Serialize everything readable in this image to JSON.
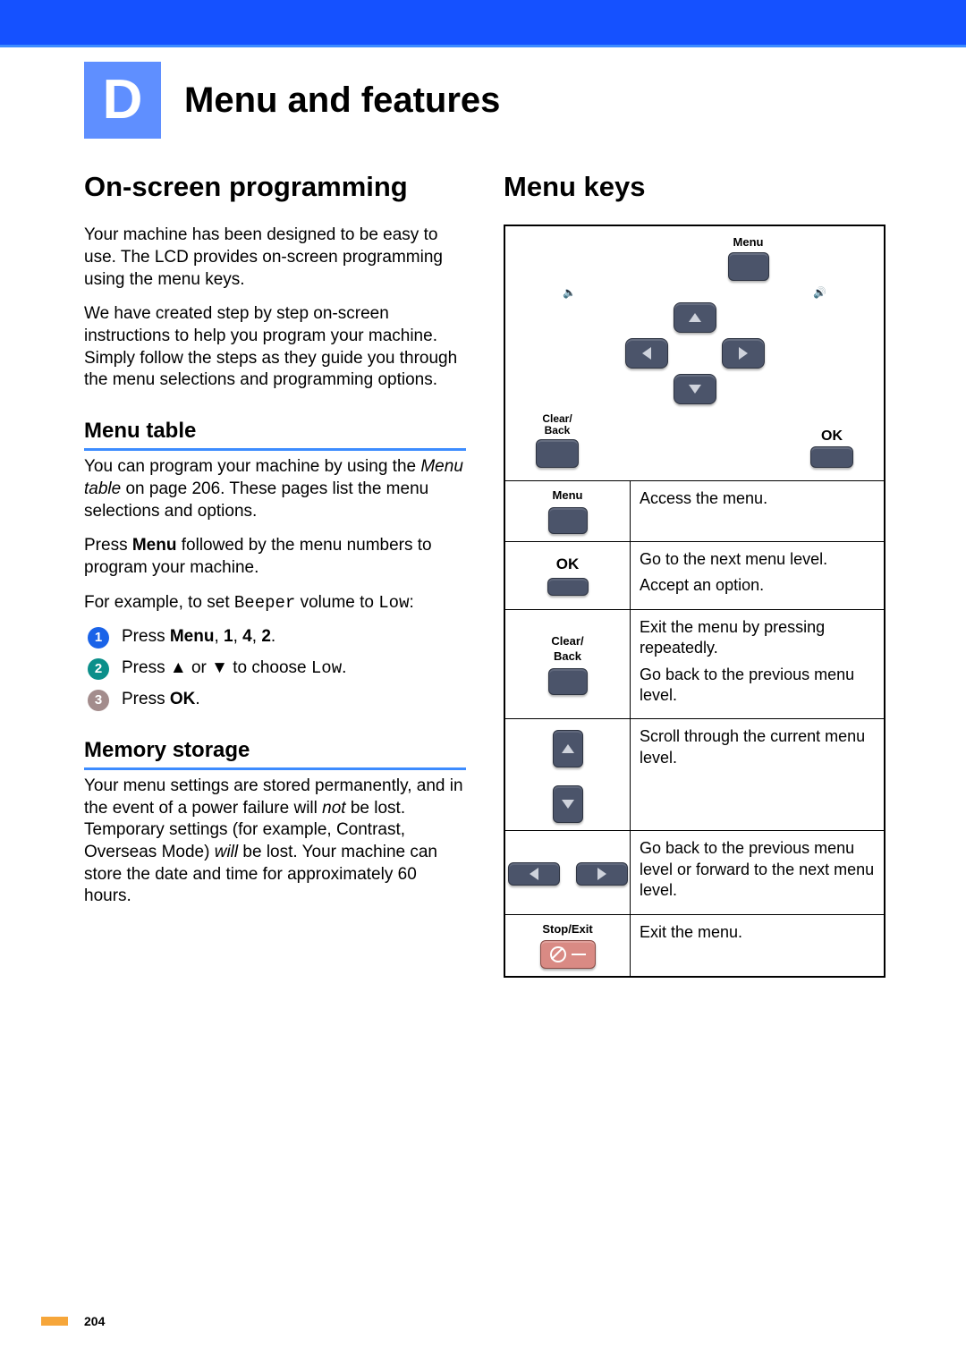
{
  "chapter": {
    "letter": "D",
    "title": "Menu and features"
  },
  "left": {
    "h2": "On-screen programming",
    "p1": "Your machine has been designed to be easy to use. The LCD provides on-screen programming using the menu keys.",
    "p2": "We have created step by step on-screen instructions to help you program your machine. Simply follow the steps as they guide you through the menu selections and programming options.",
    "h3a": "Menu table",
    "mt1_pre": "You can program your machine by using the ",
    "mt1_link": "Menu table",
    "mt1_post": " on page 206. These pages list the menu selections and options.",
    "mt2_pre": "Press ",
    "mt2_bold": "Menu",
    "mt2_post": " followed by the menu numbers to program your machine.",
    "mt3_pre": "For example, to set ",
    "mt3_mono1": "Beeper",
    "mt3_mid": " volume to ",
    "mt3_mono2": "Low",
    "mt3_post": ":",
    "step1_pre": "Press ",
    "step1_bold": "Menu",
    "step1_post": ", ",
    "step1_b1": "1",
    "step1_c1": ", ",
    "step1_b2": "4",
    "step1_c2": ", ",
    "step1_b3": "2",
    "step1_end": ".",
    "step2_pre": "Press ",
    "step2_mid": " or ",
    "step2_post": " to choose ",
    "step2_mono": "Low",
    "step2_end": ".",
    "step3_pre": "Press ",
    "step3_bold": "OK",
    "step3_end": ".",
    "h3b": "Memory storage",
    "ms_pre": "Your menu settings are stored permanently, and in the event of a power failure will ",
    "ms_i1": "not",
    "ms_mid": " be lost. Temporary settings (for example, Contrast, Overseas Mode) ",
    "ms_i2": "will",
    "ms_post": " be lost. Your machine can store the date and time for approximately 60 hours."
  },
  "right": {
    "h2": "Menu keys",
    "top_menu": "Menu",
    "top_clear1": "Clear/",
    "top_clear2": "Back",
    "top_ok": "OK",
    "rows": [
      {
        "label": "Menu",
        "desc1": "Access the menu."
      },
      {
        "ok": "OK",
        "desc1": "Go to the next menu level.",
        "desc2": "Accept an option."
      },
      {
        "clear1": "Clear/",
        "clear2": "Back",
        "desc1": "Exit the menu by pressing repeatedly.",
        "desc2": "Go back to the previous menu level."
      },
      {
        "updown": true,
        "desc1": "Scroll through the current menu level."
      },
      {
        "leftright": true,
        "desc1": "Go back to the previous menu level or forward to the next menu level."
      },
      {
        "stop": "Stop/Exit",
        "desc1": "Exit the menu."
      }
    ]
  },
  "page_number": "204"
}
